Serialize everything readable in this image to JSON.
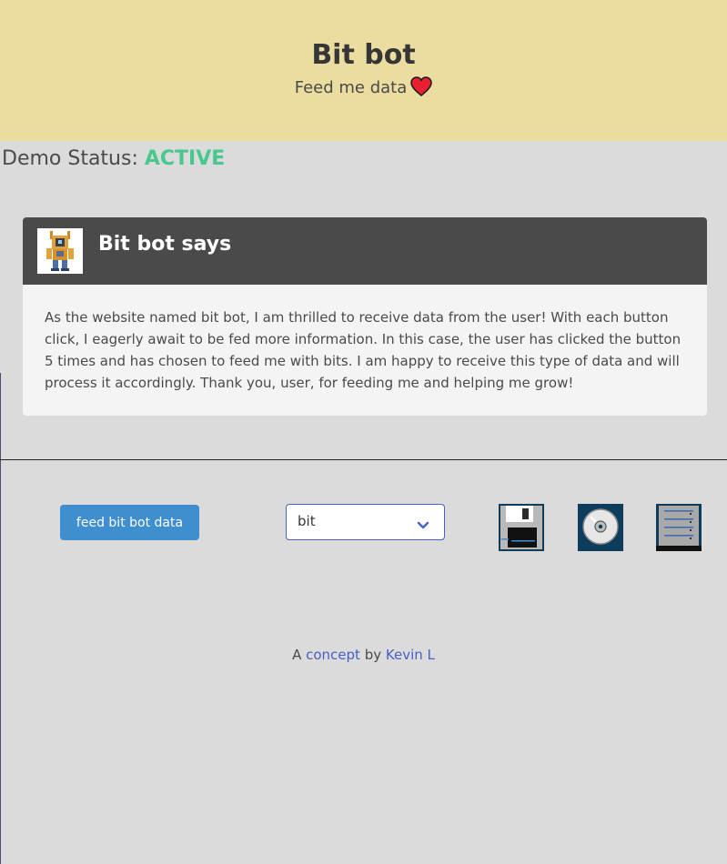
{
  "hero": {
    "title": "Bit bot",
    "subtitle": "Feed me data"
  },
  "status": {
    "label": "Demo Status:",
    "value": "ACTIVE",
    "value_color": "#48c78e"
  },
  "message": {
    "title": "Bit bot says",
    "body": "As the website named bit bot, I am thrilled to receive data from the user! With each button click, I eagerly await to be fed more information. In this case, the user has clicked the button 5 times and has chosen to feed me with bits. I am happy to receive this type of data and will process it accordingly. Thank you, user, for feeding me and helping me grow!",
    "avatar_icon": "robot-icon"
  },
  "controls": {
    "feed_button_label": "feed bit bot data",
    "select_value": "bit",
    "accent_color": "#3e8ed0",
    "icons": [
      "floppy-disk-icon",
      "cd-disc-icon",
      "server-rack-icon"
    ]
  },
  "footer": {
    "prefix": "A",
    "concept_link": "concept",
    "middle": "by",
    "author_link": "Kevin L"
  }
}
